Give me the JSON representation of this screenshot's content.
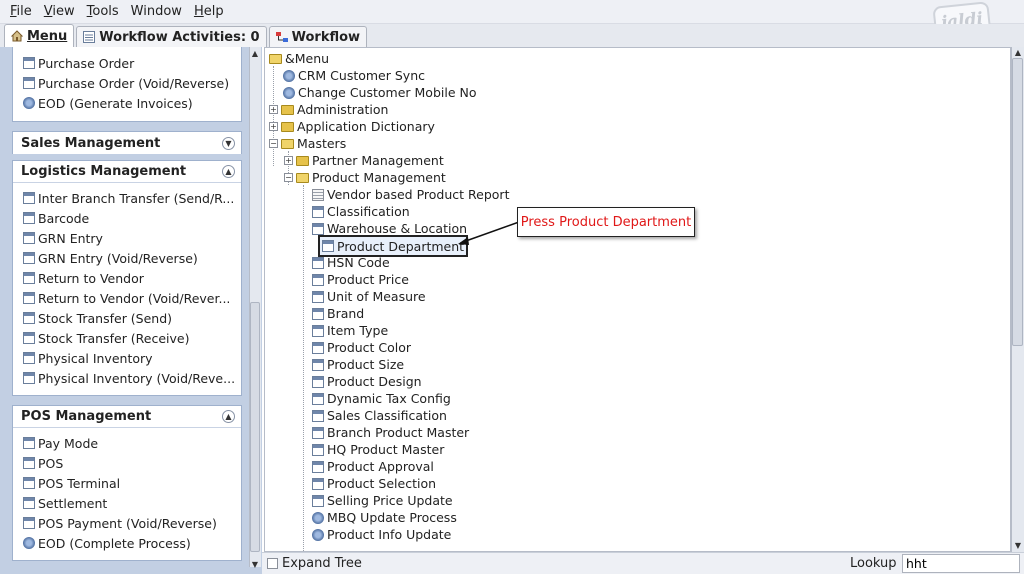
{
  "menubar": [
    {
      "pre": "",
      "u": "F",
      "post": "ile"
    },
    {
      "pre": "",
      "u": "V",
      "post": "iew"
    },
    {
      "pre": "",
      "u": "T",
      "post": "ools"
    },
    {
      "pre": "Window",
      "u": "",
      "post": ""
    },
    {
      "pre": "",
      "u": "H",
      "post": "elp"
    }
  ],
  "logo_text": "jaldi",
  "tabs": {
    "menu": "Menu",
    "workflow_activities": "Workflow Activities: 0",
    "workflow": "Workflow"
  },
  "left_panel": {
    "top_items": [
      {
        "label": "Purchase Order",
        "icon": "window"
      },
      {
        "label": "Purchase Order (Void/Reverse)",
        "icon": "window"
      },
      {
        "label": "EOD (Generate Invoices)",
        "icon": "process"
      }
    ],
    "sales": {
      "title": "Sales Management"
    },
    "logistics": {
      "title": "Logistics Management",
      "items": [
        "Inter Branch Transfer (Send/R...",
        "Barcode",
        "GRN Entry",
        "GRN Entry (Void/Reverse)",
        "Return to Vendor",
        "Return to Vendor (Void/Rever...",
        "Stock Transfer (Send)",
        "Stock Transfer (Receive)",
        "Physical Inventory",
        "Physical Inventory (Void/Reve..."
      ]
    },
    "pos": {
      "title": "POS Management",
      "items": [
        {
          "label": "Pay Mode",
          "icon": "window"
        },
        {
          "label": "POS",
          "icon": "window"
        },
        {
          "label": "POS Terminal",
          "icon": "window"
        },
        {
          "label": "Settlement",
          "icon": "window"
        },
        {
          "label": "POS Payment (Void/Reverse)",
          "icon": "window"
        },
        {
          "label": "EOD (Complete Process)",
          "icon": "process"
        }
      ]
    }
  },
  "tree": {
    "root": "&Menu",
    "crm": "CRM Customer Sync",
    "change_mobile": "Change Customer Mobile No",
    "administration": "Administration",
    "app_dictionary": "Application Dictionary",
    "masters": "Masters",
    "partner_mgmt": "Partner Management",
    "product_mgmt": "Product Management",
    "product_items": [
      {
        "label": "Vendor based Product Report",
        "icon": "report"
      },
      {
        "label": "Classification",
        "icon": "window"
      },
      {
        "label": "Warehouse & Location",
        "icon": "window"
      },
      {
        "label": "Product Department",
        "icon": "window"
      },
      {
        "label": "HSN Code",
        "icon": "window"
      },
      {
        "label": "Product Price",
        "icon": "window"
      },
      {
        "label": "Unit of Measure",
        "icon": "window"
      },
      {
        "label": "Brand",
        "icon": "window"
      },
      {
        "label": "Item Type",
        "icon": "window"
      },
      {
        "label": "Product Color",
        "icon": "window"
      },
      {
        "label": "Product Size",
        "icon": "window"
      },
      {
        "label": "Product Design",
        "icon": "window"
      },
      {
        "label": "Dynamic Tax Config",
        "icon": "window"
      },
      {
        "label": "Sales Classification",
        "icon": "window"
      },
      {
        "label": "Branch Product Master",
        "icon": "window"
      },
      {
        "label": "HQ Product Master",
        "icon": "window"
      },
      {
        "label": "Product Approval",
        "icon": "window"
      },
      {
        "label": "Product Selection",
        "icon": "window"
      },
      {
        "label": "Selling Price Update",
        "icon": "window"
      },
      {
        "label": "MBQ Update Process",
        "icon": "process"
      },
      {
        "label": "Product Info Update",
        "icon": "process"
      }
    ]
  },
  "callout_text": "Press Product Department",
  "bottom": {
    "expand_tree": "Expand Tree",
    "lookup_label": "Lookup",
    "lookup_value": "hht"
  },
  "colors": {
    "callout_text": "#e01818",
    "left_bg": "#c2cfe3",
    "folder": "#e6c24a"
  }
}
